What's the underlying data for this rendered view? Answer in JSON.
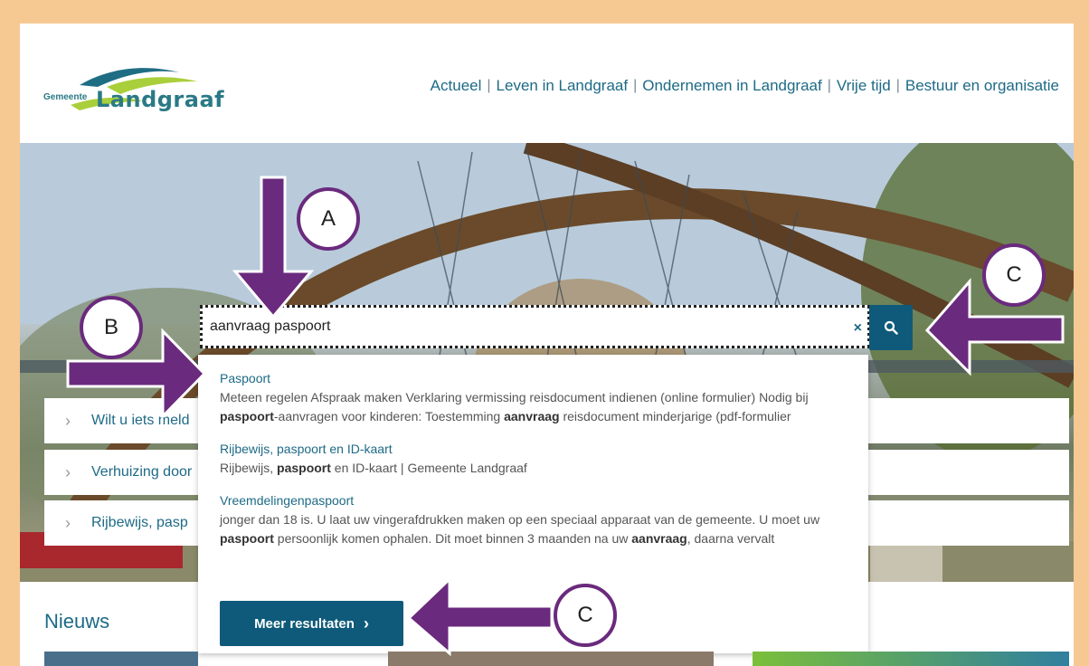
{
  "logo": {
    "prefix": "Gemeente",
    "name": "Landgraaf"
  },
  "nav": [
    "Actueel",
    "Leven in Landgraaf",
    "Ondernemen in Landgraaf",
    "Vrije tijd",
    "Bestuur en organisatie"
  ],
  "search": {
    "value": "aanvraag paspoort",
    "clear": "×",
    "button_icon": "search-icon"
  },
  "quick_links": [
    "Wilt u iets meld",
    "Verhuizing door",
    "Rijbewijs, pasp"
  ],
  "results": [
    {
      "title": "Paspoort",
      "desc_parts": [
        "Meteen regelen Afspraak maken Verklaring vermissing reisdocument indienen (online formulier) Nodig bij ",
        "paspoort",
        "-aanvragen voor kinderen: Toestemming ",
        "aanvraag",
        " reisdocument minderjarige (pdf-formulier"
      ]
    },
    {
      "title": "Rijbewijs, paspoort en ID-kaart",
      "desc_parts": [
        "Rijbewijs, ",
        "paspoort",
        " en ID-kaart | Gemeente Landgraaf"
      ]
    },
    {
      "title": "Vreemdelingenpaspoort",
      "desc_parts": [
        "jonger dan 18 is. U laat uw vingerafdrukken maken op een speciaal apparaat van de gemeente. U moet uw ",
        "paspoort",
        " persoonlijk komen ophalen. Dit moet binnen 3 maanden na uw ",
        "aanvraag",
        ", daarna vervalt"
      ]
    }
  ],
  "more_button": "Meer resultaten",
  "news_heading": "Nieuws",
  "annotations": [
    "A",
    "B",
    "C",
    "C"
  ],
  "colors": {
    "accent": "#0f5a7a",
    "link": "#1d6a86",
    "annotation": "#6a2a7d",
    "frame": "#f6c993"
  }
}
